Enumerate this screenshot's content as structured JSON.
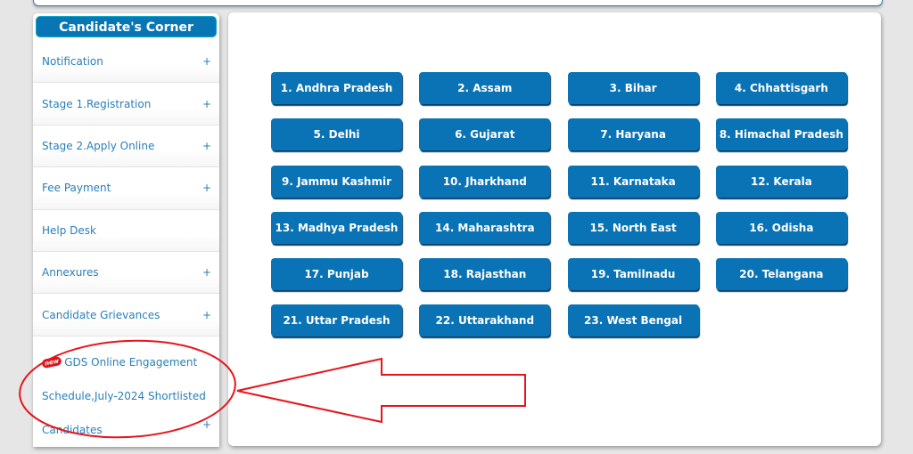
{
  "sidebar": {
    "title": "Candidate's Corner",
    "items": [
      {
        "label": "Notification",
        "expand": "+"
      },
      {
        "label": "Stage 1.Registration",
        "expand": "+"
      },
      {
        "label": "Stage 2.Apply Online",
        "expand": "+"
      },
      {
        "label": "Fee Payment",
        "expand": "+"
      },
      {
        "label": "Help Desk",
        "expand": ""
      },
      {
        "label": "Annexures",
        "expand": "+"
      },
      {
        "label": "Candidate Grievances",
        "expand": "+"
      }
    ],
    "highlight_item": {
      "badge": "new",
      "line1": "GDS Online Engagement",
      "line2": "Schedule,July-2024 Shortlisted",
      "line3": "Candidates",
      "expand": "+"
    }
  },
  "states": [
    "1. Andhra Pradesh",
    "2. Assam",
    "3. Bihar",
    "4. Chhattisgarh",
    "5. Delhi",
    "6. Gujarat",
    "7. Haryana",
    "8. Himachal Pradesh",
    "9. Jammu Kashmir",
    "10. Jharkhand",
    "11. Karnataka",
    "12. Kerala",
    "13. Madhya Pradesh",
    "14. Maharashtra",
    "15. North East",
    "16. Odisha",
    "17. Punjab",
    "18. Rajasthan",
    "19. Tamilnadu",
    "20. Telangana",
    "21. Uttar Pradesh",
    "22. Uttarakhand",
    "23. West Bengal"
  ],
  "colors": {
    "button_blue": "#0a73b5",
    "link_blue": "#2a7fb8",
    "annotation_red": "#e8141c"
  }
}
